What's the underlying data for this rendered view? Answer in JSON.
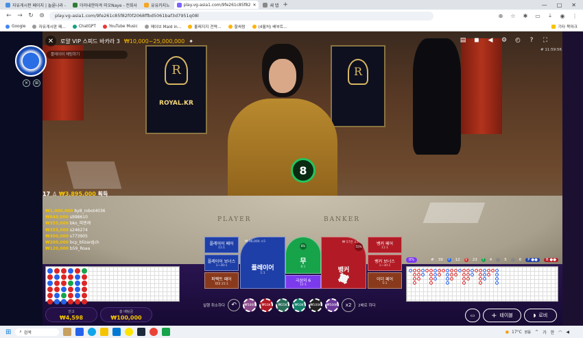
{
  "browser": {
    "tabs": [
      {
        "label": "자유게시판 페이지 | 놀륜나라 -",
        "color": "#4a90e2"
      },
      {
        "label": "더러내한마격 미오Naye - 전회사",
        "color": "#2e7d32"
      },
      {
        "label": "유유카지노",
        "color": "#f5a623"
      },
      {
        "label": "play.vg-asia1.com/9fe261c85f82",
        "color": "#7b61ff"
      },
      {
        "label": "새 탭",
        "color": "#888888"
      }
    ],
    "url": "play.vg-asia1.com/9fe261c85f82f0f2068ffbd5061baf3d7951q08l",
    "bookmarks": [
      "Google",
      "자유게시판 페...",
      "ChatGPT",
      "YouTube Music",
      "메이브 Maid in...",
      "홀레지지 전략...",
      "할싸람",
      "(4월처) 배부트..."
    ],
    "bookmark_right": "기타 북마크",
    "window_controls": [
      "—",
      "□",
      "✕"
    ]
  },
  "game": {
    "title": "로얄 VIP 스피드 바카라 3",
    "limit": "₩10,000~25,000,000",
    "search_placeholder": "플레이어 채팅하기",
    "time": "# 11:59:56",
    "timer": "8",
    "player_count": "17",
    "total_bet": "₩3,895,000",
    "total_bet_suffix": "획득",
    "table_text_player": "PLAYER",
    "table_text_banker": "BANKER",
    "backdrop_text": "ROYAL.KR",
    "winners": [
      {
        "amount": "₩1,000,000",
        "name": "by8_robot4036"
      },
      {
        "amount": "₩840,000",
        "name": "s998610"
      },
      {
        "amount": "₩355,000",
        "name": "bko_피엔제"
      },
      {
        "amount": "₩355,000",
        "name": "s246274"
      },
      {
        "amount": "₩300,000",
        "name": "s773905"
      },
      {
        "amount": "₩200,000",
        "name": "bcp_blizardjch"
      },
      {
        "amount": "₩120,000",
        "name": "b59_Roaa"
      }
    ]
  },
  "bets": {
    "player_pair": {
      "label": "플레이어 페어",
      "odds": "11:1"
    },
    "player_bonus": {
      "label": "플레이어 보너스",
      "odds": "1~30:1"
    },
    "perfect_pair": {
      "label": "퍼펙트 페어",
      "odds": "최대 25:1"
    },
    "player": {
      "label": "플레이어",
      "odds": "1:1",
      "stat": "₩ 36,000",
      "count": "5"
    },
    "tie": {
      "label": "무",
      "odds": "8:1",
      "pct": "8%"
    },
    "super6": {
      "label": "극상의 6",
      "odds": "12:1"
    },
    "banker": {
      "label": "뱅커",
      "stat": "₩ 57만",
      "count": "7",
      "pct": "55%"
    },
    "banker_pair": {
      "label": "뱅커 페어",
      "odds": "11:1"
    },
    "banker_bonus": {
      "label": "뱅커 보너스",
      "odds": "1~30:1"
    },
    "either_pair": {
      "label": "이더 페어",
      "odds": "5:1"
    }
  },
  "roads": {
    "head_pct": "0%",
    "stats": [
      {
        "label": "#",
        "value": "39"
      },
      {
        "label": "P",
        "value": "12"
      },
      {
        "label": "B",
        "value": "23"
      },
      {
        "label": "T",
        "value": "4"
      },
      {
        "label": "",
        "value": "5"
      },
      {
        "label": "",
        "value": "6"
      }
    ]
  },
  "controls": {
    "undo_label": "실행 취소하다",
    "chips": [
      "₩5000",
      "₩10K",
      "₩25K",
      "₩50K",
      "₩100K",
      "₩500K"
    ],
    "double_label": "x2",
    "double_text": "2배로 하다",
    "balance_label": "잔고",
    "balance_value": "₩4,598",
    "bet_label": "총 베팅금",
    "bet_value": "₩100,000",
    "table_button": "테이블",
    "lobby_button": "로비"
  },
  "taskbar": {
    "search": "검색",
    "weather": "17°C",
    "weather_sub": "맑음",
    "lang": "가",
    "ime": "한"
  }
}
